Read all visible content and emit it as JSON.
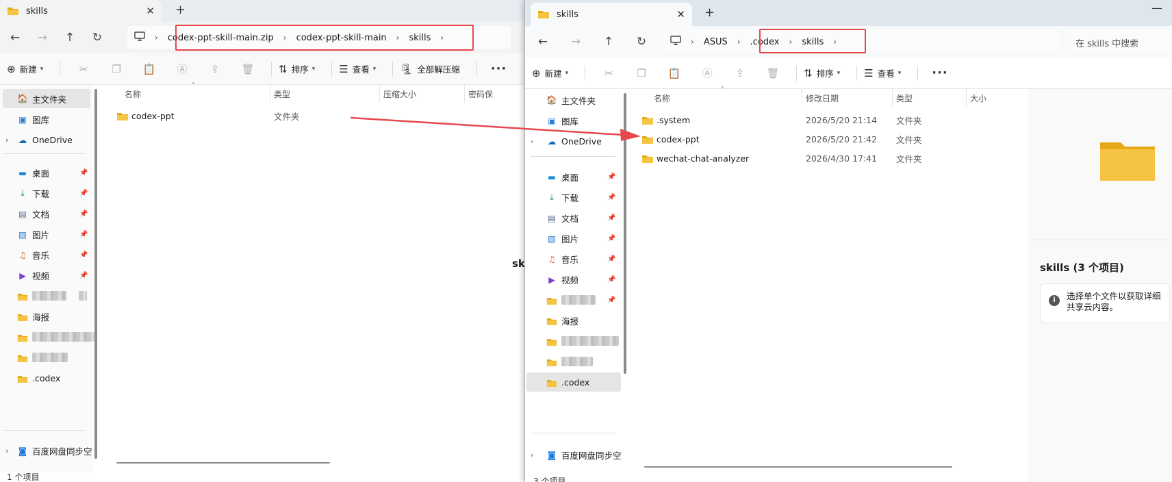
{
  "colors": {
    "highlight": "#e5484d",
    "folder": "#f5c443",
    "folder_dark": "#e6a817",
    "selected": "#e5e5e5"
  },
  "left": {
    "tab": {
      "title": "skills",
      "close": "✕",
      "new_tab": "+"
    },
    "breadcrumb": [
      "codex-ppt-skill-main.zip",
      "codex-ppt-skill-main",
      "skills"
    ],
    "toolbar": {
      "new_label": "新建",
      "sort_label": "排序",
      "view_label": "查看",
      "extract_label": "全部解压缩"
    },
    "sidebar": {
      "home": "主文件夹",
      "gallery": "图库",
      "onedrive": "OneDrive",
      "desktop": "桌面",
      "downloads": "下载",
      "documents": "文档",
      "pictures": "图片",
      "music": "音乐",
      "videos": "视频",
      "poster": "海报",
      "codex": ".codex",
      "baidu": "百度网盘同步空"
    },
    "columns": {
      "name": "名称",
      "type": "类型",
      "compressed_size": "压缩大小",
      "password": "密码保"
    },
    "files": [
      {
        "name": "codex-ppt",
        "type": "文件夹"
      }
    ],
    "status": "1 个项目",
    "peek_title": "sk"
  },
  "right": {
    "tab": {
      "title": "skills",
      "close": "✕",
      "new_tab": "+",
      "minimize": "—"
    },
    "breadcrumb": [
      "ASUS",
      ".codex",
      "skills"
    ],
    "search_placeholder": "在 skills 中搜索",
    "toolbar": {
      "new_label": "新建",
      "sort_label": "排序",
      "view_label": "查看"
    },
    "sidebar": {
      "home": "主文件夹",
      "gallery": "图库",
      "onedrive": "OneDrive",
      "desktop": "桌面",
      "downloads": "下载",
      "documents": "文档",
      "pictures": "图片",
      "music": "音乐",
      "videos": "视频",
      "poster": "海报",
      "codex": ".codex",
      "baidu": "百度网盘同步空"
    },
    "columns": {
      "name": "名称",
      "modified": "修改日期",
      "type": "类型",
      "size": "大小"
    },
    "files": [
      {
        "name": ".system",
        "modified": "2026/5/20 21:14",
        "type": "文件夹"
      },
      {
        "name": "codex-ppt",
        "modified": "2026/5/20 21:42",
        "type": "文件夹"
      },
      {
        "name": "wechat-chat-analyzer",
        "modified": "2026/4/30 17:41",
        "type": "文件夹"
      }
    ],
    "details": {
      "title": "skills (3 个项目)",
      "info_line1": "选择单个文件以获取详细",
      "info_line2": "共享云内容。"
    },
    "status": "3 个项目"
  }
}
